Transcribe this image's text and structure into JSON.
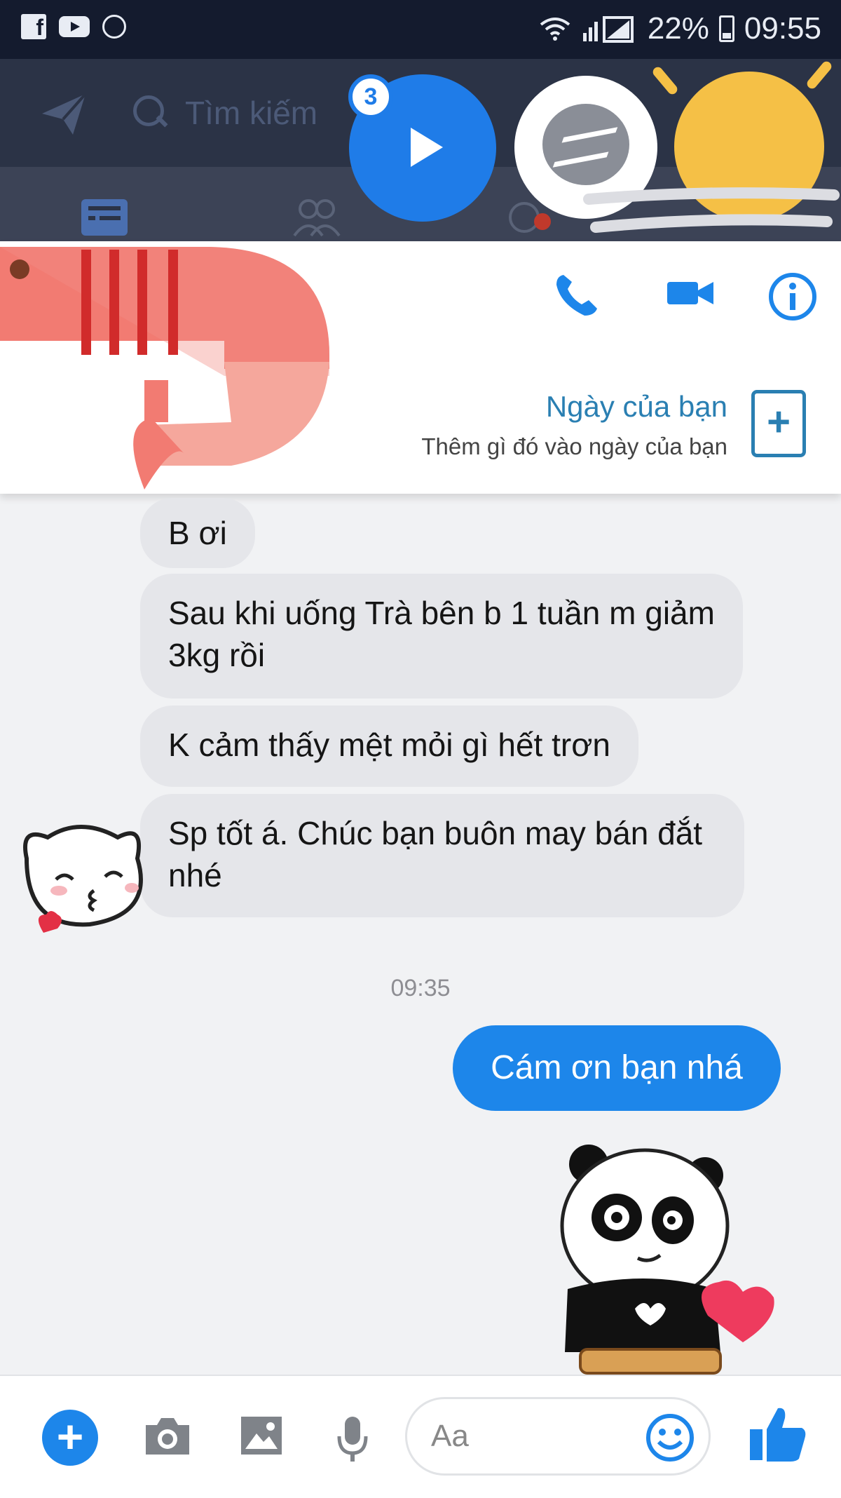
{
  "status_bar": {
    "battery_percent": "22%",
    "time": "09:55",
    "icons": [
      "facebook-icon",
      "youtube-icon",
      "sun-icon",
      "wifi-icon",
      "signal-icon",
      "battery-icon"
    ]
  },
  "top_bar": {
    "search_placeholder": "Tìm kiếm",
    "bubble_badge_count": "3"
  },
  "header": {
    "day_title": "Ngày của bạn",
    "day_subtitle": "Thêm gì đó vào ngày của bạn",
    "add_label": "+"
  },
  "chat": {
    "incoming": [
      {
        "text": "B ơi"
      },
      {
        "text": "Sau khi uống Trà bên b 1 tuần m giảm 3kg rồi"
      },
      {
        "text": "K cảm thấy mệt mỏi gì hết trơn"
      },
      {
        "text": "Sp tốt á. Chúc bạn buôn may bán đắt nhé"
      }
    ],
    "timestamp": "09:35",
    "outgoing": [
      {
        "text": "Cám ơn bạn nhá"
      }
    ]
  },
  "composer": {
    "placeholder": "Aa",
    "plus_label": "+"
  },
  "colors": {
    "messenger_blue": "#1d86ea",
    "incoming_bubble": "#e5e6ea",
    "status_bar": "#141b2e",
    "day_accent": "#2a7fb2"
  }
}
